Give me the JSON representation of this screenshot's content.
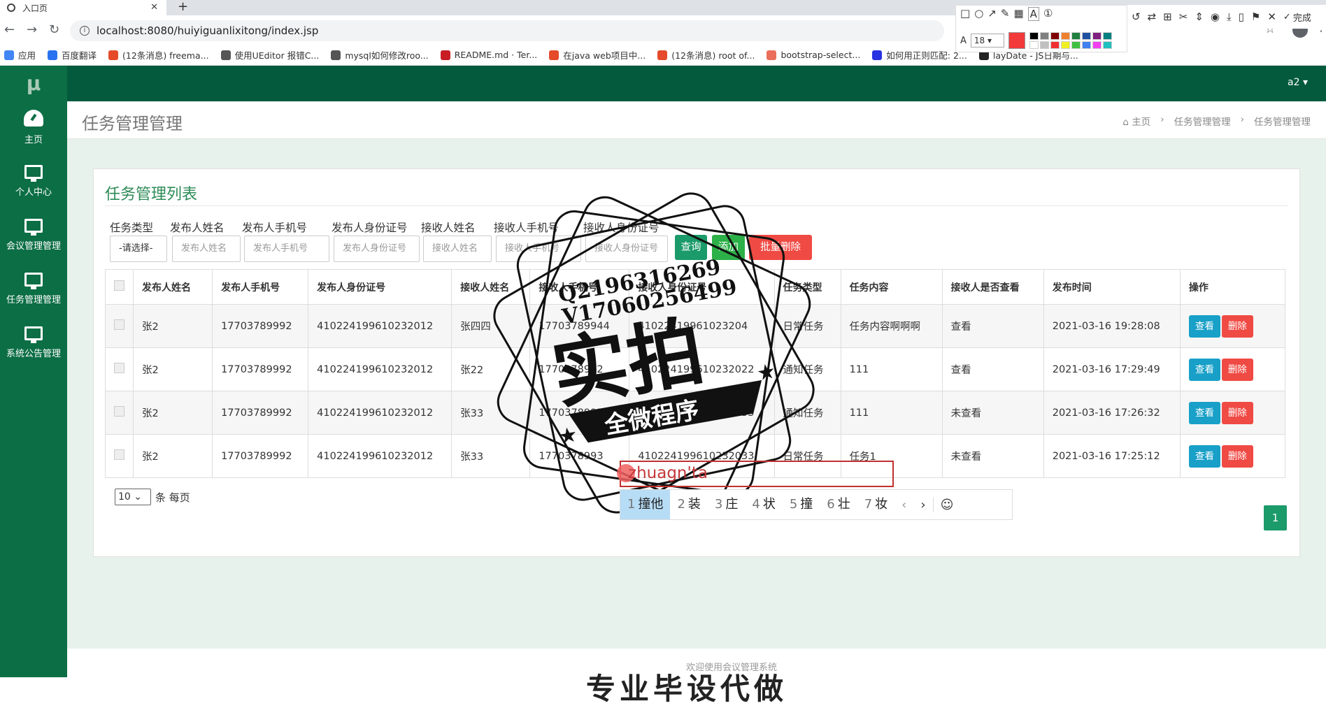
{
  "browser": {
    "tab_title": "入口页",
    "url": "localhost:8080/huiyiguanlixitong/index.jsp",
    "bookmarks": [
      {
        "label": "应用",
        "icon": "apps-grid-icon",
        "color": "#4285f4"
      },
      {
        "label": "百度翻译",
        "icon": "translate-icon",
        "color": "#2b72f0"
      },
      {
        "label": "(12条消息) freema...",
        "icon": "csdn-icon",
        "color": "#e54b2a"
      },
      {
        "label": "使用UEditor 报错C...",
        "icon": "bookmark-icon",
        "color": "#555555"
      },
      {
        "label": "mysql如何修改roo...",
        "icon": "bookmark-icon",
        "color": "#555555"
      },
      {
        "label": "README.md · Ter...",
        "icon": "gitee-icon",
        "color": "#c71d23"
      },
      {
        "label": "在java web项目中...",
        "icon": "csdn-icon",
        "color": "#e54b2a"
      },
      {
        "label": "(12条消息) root of...",
        "icon": "csdn-icon",
        "color": "#e54b2a"
      },
      {
        "label": "bootstrap-select...",
        "icon": "jianshu-icon",
        "color": "#ea6f5a"
      },
      {
        "label": "如何用正则匹配: 2...",
        "icon": "baidu-icon",
        "color": "#2932e1"
      },
      {
        "label": "layDate - JS日期与...",
        "icon": "layui-icon",
        "color": "#222222"
      }
    ]
  },
  "snip_toolbar": {
    "font_size": "18",
    "done_label": "完成",
    "active_color": "#f23a3a",
    "palette": [
      "#000000",
      "#808080",
      "#800000",
      "#f08030",
      "#208040",
      "#2050a0",
      "#802080",
      "#008080",
      "#ffffff",
      "#c0c0c0",
      "#f03030",
      "#f0f020",
      "#40c040",
      "#4080f0",
      "#f040f0",
      "#20c0c0"
    ]
  },
  "sidebar": {
    "logo": "μ",
    "items": [
      {
        "label": "主页",
        "icon": "dashboard-icon"
      },
      {
        "label": "个人中心",
        "icon": "monitor-icon"
      },
      {
        "label": "会议管理管理",
        "icon": "monitor-icon"
      },
      {
        "label": "任务管理管理",
        "icon": "monitor-icon"
      },
      {
        "label": "系统公告管理",
        "icon": "monitor-icon"
      }
    ]
  },
  "topnav": {
    "user": "a2 ▾"
  },
  "page": {
    "title": "任务管理管理",
    "breadcrumb": [
      "主页",
      "任务管理管理",
      "任务管理管理"
    ]
  },
  "card": {
    "title": "任务管理列表",
    "filters": [
      {
        "label": "任务类型",
        "value": "-请选择-",
        "kind": "select"
      },
      {
        "label": "发布人姓名",
        "placeholder": "发布人姓名"
      },
      {
        "label": "发布人手机号",
        "placeholder": "发布人手机号"
      },
      {
        "label": "发布人身份证号",
        "placeholder": "发布人身份证号"
      },
      {
        "label": "接收人姓名",
        "placeholder": "接收人姓名"
      },
      {
        "label": "接收人手机号",
        "placeholder": "接收人手机号"
      },
      {
        "label": "接收人身份证号",
        "placeholder": "接收人身份证号"
      }
    ],
    "buttons": {
      "query": "查询",
      "add": "添加",
      "batch_delete": "批量删除"
    },
    "columns": [
      "发布人姓名",
      "发布人手机号",
      "发布人身份证号",
      "接收人姓名",
      "接收人手机号",
      "接收人身份证号",
      "任务类型",
      "任务内容",
      "接收人是否查看",
      "发布时间",
      "操作"
    ],
    "rows": [
      [
        "张2",
        "17703789992",
        "410224199610232012",
        "张四四",
        "17703789944",
        "41022419961023204",
        "日常任务",
        "任务内容啊啊啊",
        "查看",
        "2021-03-16 19:28:08"
      ],
      [
        "张2",
        "17703789992",
        "410224199610232012",
        "张22",
        "1770378992",
        "410224199610232022",
        "通知任务",
        "111",
        "查看",
        "2021-03-16 17:29:49"
      ],
      [
        "张2",
        "17703789992",
        "410224199610232012",
        "张33",
        "1770378993",
        "410224199610232033",
        "通知任务",
        "111",
        "未查看",
        "2021-03-16 17:26:32"
      ],
      [
        "张2",
        "17703789992",
        "410224199610232012",
        "张33",
        "1770378993",
        "410224199610232033",
        "日常任务",
        "任务1",
        "未查看",
        "2021-03-16 17:25:12"
      ]
    ],
    "row_actions": {
      "view": "查看",
      "delete": "删除"
    },
    "page_size": "10",
    "page_size_suffix": "条 每页",
    "current_page": "1"
  },
  "footer": {
    "text": "欢迎使用会议管理系统",
    "overlay": "专业毕设代做"
  },
  "ime": {
    "input": "zhuagn'ta",
    "candidates": [
      {
        "n": "1",
        "t": "撞他"
      },
      {
        "n": "2",
        "t": "装"
      },
      {
        "n": "3",
        "t": "庄"
      },
      {
        "n": "4",
        "t": "状"
      },
      {
        "n": "5",
        "t": "撞"
      },
      {
        "n": "6",
        "t": "壮"
      },
      {
        "n": "7",
        "t": "妆"
      }
    ]
  },
  "stamp": {
    "line1": "Q2196316269",
    "line2": "V17060256499",
    "big": "实拍",
    "banner": "全微程序"
  }
}
